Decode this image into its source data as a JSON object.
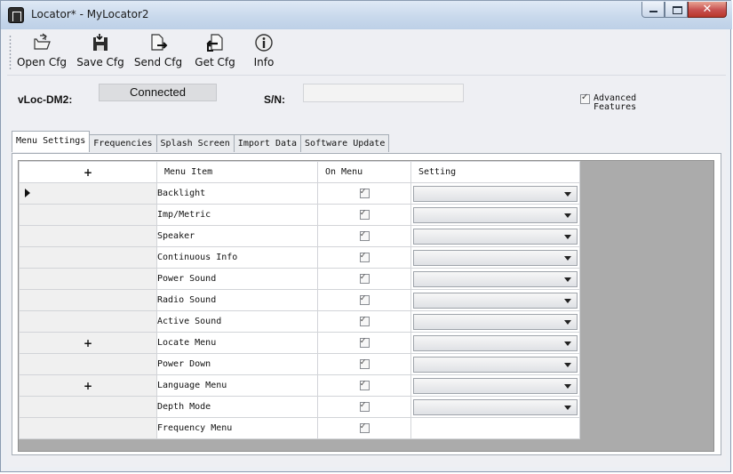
{
  "window": {
    "title": "Locator* - MyLocator2"
  },
  "toolbar": {
    "buttons": [
      {
        "label": "Open Cfg",
        "icon": "open-folder-icon"
      },
      {
        "label": "Save Cfg",
        "icon": "save-disk-icon"
      },
      {
        "label": "Send Cfg",
        "icon": "send-document-icon"
      },
      {
        "label": "Get Cfg",
        "icon": "get-document-icon"
      },
      {
        "label": "Info",
        "icon": "info-icon"
      }
    ]
  },
  "device": {
    "label": "vLoc-DM2:",
    "status": "Connected",
    "sn_label": "S/N:",
    "sn_value": "",
    "advanced_line1": "Advanced",
    "advanced_line2": "Features",
    "advanced_checked": true
  },
  "tabs": [
    "Menu Settings",
    "Frequencies",
    "Splash Screen",
    "Import Data",
    "Software Update"
  ],
  "active_tab": "Menu Settings",
  "grid": {
    "header_plus": "+",
    "columns": [
      "Menu Item",
      "On Menu",
      "Setting"
    ],
    "rows": [
      {
        "prefix": "",
        "name": "Backlight",
        "on_menu": true,
        "has_dropdown": true
      },
      {
        "prefix": "",
        "name": "Imp/Metric",
        "on_menu": true,
        "has_dropdown": true
      },
      {
        "prefix": "",
        "name": "Speaker",
        "on_menu": true,
        "has_dropdown": true
      },
      {
        "prefix": "",
        "name": "Continuous Info",
        "on_menu": true,
        "has_dropdown": true
      },
      {
        "prefix": "",
        "name": "Power Sound",
        "on_menu": true,
        "has_dropdown": true
      },
      {
        "prefix": "",
        "name": "Radio Sound",
        "on_menu": true,
        "has_dropdown": true
      },
      {
        "prefix": "",
        "name": "Active Sound",
        "on_menu": true,
        "has_dropdown": true
      },
      {
        "prefix": "+",
        "name": "Locate Menu",
        "on_menu": true,
        "has_dropdown": true
      },
      {
        "prefix": "",
        "name": "Power Down",
        "on_menu": true,
        "has_dropdown": true
      },
      {
        "prefix": "+",
        "name": "Language Menu",
        "on_menu": true,
        "has_dropdown": true
      },
      {
        "prefix": "",
        "name": "Depth Mode",
        "on_menu": true,
        "has_dropdown": true
      },
      {
        "prefix": "",
        "name": "Frequency Menu",
        "on_menu": true,
        "has_dropdown": false
      }
    ]
  }
}
